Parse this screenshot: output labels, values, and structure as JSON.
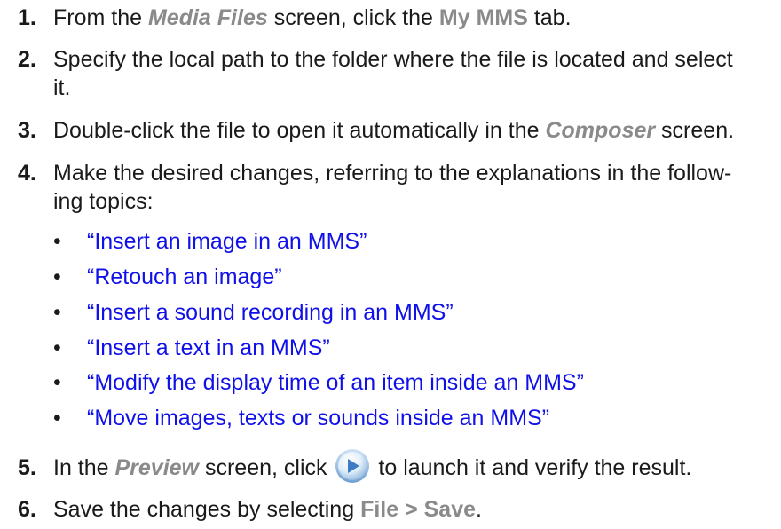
{
  "steps": [
    {
      "num": "1.",
      "parts": {
        "a": "From the ",
        "screen": "Media Files",
        "b": " screen, click the ",
        "tab": "My MMS",
        "c": " tab."
      }
    },
    {
      "num": "2.",
      "line1": "Specify the local path to the folder where the file is located and select",
      "line2": "it."
    },
    {
      "num": "3.",
      "parts": {
        "a": "Double-click the file to open it automatically in the ",
        "screen": "Composer",
        "b": " screen."
      }
    },
    {
      "num": "4.",
      "line1": "Make the desired changes, referring to the explanations in the follow-",
      "line2": "ing topics:",
      "links": [
        "“Insert an image in an MMS”",
        "“Retouch an image”",
        "“Insert a sound recording in an MMS”",
        "“Insert a text in an MMS”",
        "“Modify the display time of an item inside an MMS”",
        "“Move images, texts or sounds inside an MMS”"
      ]
    },
    {
      "num": "5.",
      "parts": {
        "a": "In the ",
        "screen": "Preview",
        "b": " screen, click ",
        "c": " to launch it and verify the result."
      },
      "icon": "play-button-icon"
    },
    {
      "num": "6.",
      "parts": {
        "a": "Save the changes by selecting ",
        "menu": "File > Save",
        "b": "."
      }
    }
  ],
  "bullet_char": "•",
  "colors": {
    "text": "#1a1a1a",
    "ui_label": "#8a8a8a",
    "link": "#1010e8"
  }
}
